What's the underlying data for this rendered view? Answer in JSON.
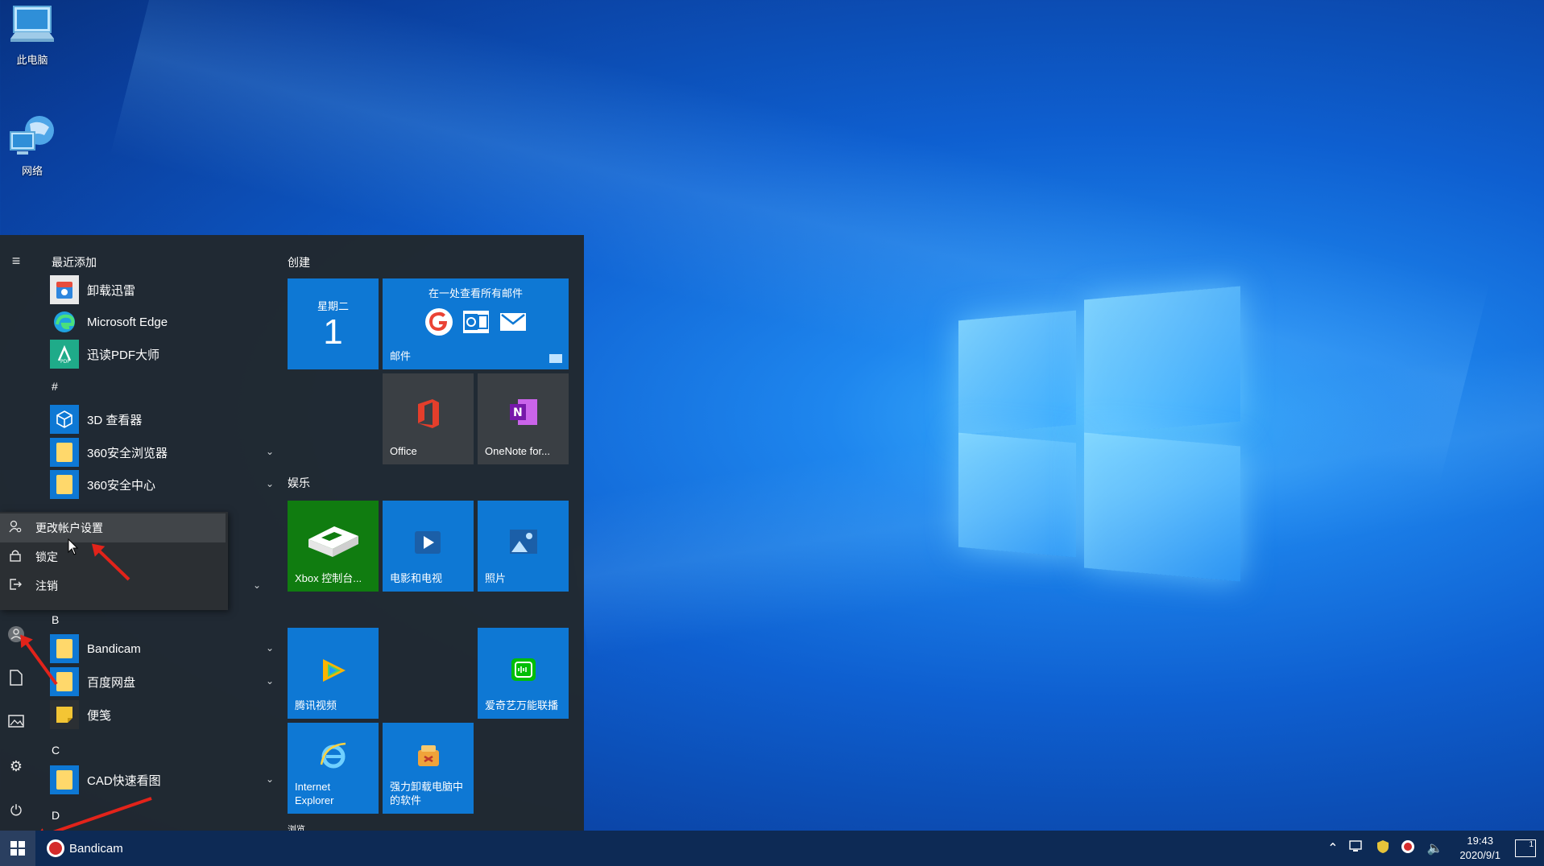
{
  "desktop": {
    "icons": [
      {
        "label": "此电脑",
        "icon": "this-pc-icon"
      },
      {
        "label": "网络",
        "icon": "network-icon"
      }
    ]
  },
  "start_menu": {
    "rail": [
      "hamburger-menu-icon",
      "user-avatar-icon",
      "documents-icon",
      "pictures-icon",
      "settings-icon",
      "power-icon"
    ],
    "groups": {
      "recent": "最近添加",
      "hash": "#",
      "b": "B",
      "c": "C",
      "d": "D"
    },
    "apps": {
      "xunlei": "卸载迅雷",
      "edge": "Microsoft Edge",
      "pdf": "迅读PDF大师",
      "viewer3d": "3D 查看器",
      "browser360": "360安全浏览器",
      "center360": "360安全中心",
      "bandicam": "Bandicam",
      "baidu": "百度网盘",
      "sticky": "便笺",
      "cad": "CAD快速看图"
    },
    "user_popup": {
      "change_account": "更改帐户设置",
      "lock": "锁定",
      "signout": "注销"
    },
    "tiles": {
      "create_head": "创建",
      "entertainment_head": "娱乐",
      "cut_head": "浏览",
      "calendar_day": "星期二",
      "calendar_date": "1",
      "mail_top": "在一处查看所有邮件",
      "mail_label": "邮件",
      "office": "Office",
      "onenote": "OneNote for...",
      "xbox": "Xbox 控制台...",
      "movies": "电影和电视",
      "photos": "照片",
      "tencent": "腾讯视频",
      "iqiyi": "爱奇艺万能联播",
      "ie": "Internet Explorer",
      "uninstall": "强力卸载电脑中的软件"
    }
  },
  "taskbar": {
    "app": "Bandicam",
    "time": "19:43",
    "date": "2020/9/1",
    "notif_count": "1"
  },
  "colors": {
    "tile_blue": "#0e78d4",
    "start_bg": "#21282e",
    "taskbar": "#0d2a55",
    "annotation_red": "#e2231a"
  }
}
